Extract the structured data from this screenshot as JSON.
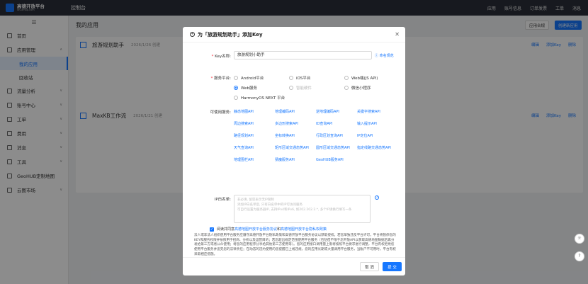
{
  "topbar": {
    "logo_title": "高德开放平台",
    "logo_sub": "lbs.amap.com",
    "console": "控制台",
    "nav": [
      "应用",
      "账号信息",
      "订单发票",
      "工单",
      "消息"
    ]
  },
  "sidebar": {
    "collapse": "☰",
    "items": [
      {
        "label": "首页"
      },
      {
        "label": "应用管理",
        "arrow": "∧"
      },
      {
        "label": "流量分析",
        "arrow": "∨"
      },
      {
        "label": "账号中心",
        "arrow": "∨"
      },
      {
        "label": "工单",
        "arrow": "∨"
      },
      {
        "label": "费用",
        "arrow": "∨"
      },
      {
        "label": "消息",
        "arrow": "∨"
      },
      {
        "label": "工具",
        "arrow": "∨"
      },
      {
        "label": "GeoHUB定制地图"
      },
      {
        "label": "云图市场",
        "arrow": "∨"
      }
    ],
    "sub_items": [
      "我的应用",
      "回收站"
    ]
  },
  "main": {
    "title": "我的应用",
    "btn_compliance": "应用合规",
    "btn_create": "创建新应用",
    "apps": [
      {
        "name": "旅游规划助手",
        "date": "2026/1/26 创建"
      },
      {
        "name": "MaxKB工作流",
        "date": "2026/1/21 创建"
      }
    ],
    "app_actions": [
      "编辑",
      "添加Key",
      "删除"
    ]
  },
  "modal": {
    "title": "为「旅游规划助手」添加Key",
    "close": "✕",
    "key_label": "Key名称:",
    "key_value": "旅游规划小助手",
    "naming_rule": "命名规范",
    "platform_label": "服务平台:",
    "platforms": [
      {
        "label": "Android平台",
        "checked": false,
        "disabled": false
      },
      {
        "label": "iOS平台",
        "checked": false,
        "disabled": false
      },
      {
        "label": "Web端(JS API)",
        "checked": false,
        "disabled": false
      },
      {
        "label": "Web服务",
        "checked": true,
        "disabled": false
      },
      {
        "label": "智能硬件",
        "checked": false,
        "disabled": true
      },
      {
        "label": "微信小程序",
        "checked": false,
        "disabled": false
      },
      {
        "label": "HarmonyOS NEXT 平台",
        "checked": false,
        "disabled": false
      }
    ],
    "services_label": "可使用服务:",
    "services": [
      "静态地图API",
      "地理编码API",
      "逆地理编码API",
      "关键字搜索API",
      "周边搜索API",
      "多边形搜索API",
      "ID查询API",
      "输入提示API",
      "路径规划API",
      "坐标转换API",
      "行政区划查询API",
      "IP定位API",
      "天气查询API",
      "矩形区域交通态势API",
      "圆形区域交通态势API",
      "指定线路交通态势API",
      "地理围栏API",
      "猜魔服务API",
      "GeoHUB服务API"
    ],
    "ip_label": "IP白名单:",
    "ip_placeholder": "非必填, 留空表示无IP限制\n添加IP白名单后, 只有白名单中的IP可访问服务\n可自行设置为服务器IP, 支持IPv4和IPv6, 如202.202.2.*, 多个IP请换行填写一条",
    "help": "?",
    "agree_text": "阅读并同意",
    "agree_link1": "高德地图开放平台服务协议",
    "agree_and": "和",
    "agree_link2": "高德地图开放平台隐私权政策",
    "terms": "法人或非法人组织使用平台服务应遵守高德开放平台隐私政策和高德开放平台服务协议以获取授权。若您单独违反平台许可，平台将暂停您的KEY和服务权限并依照用于招商、分析以及运营目的；若您超出规定范围使用平台服务（包括但不限于您开放API以获取高德地图数据后再分发给第三方或者公众使用；将您的应用程序分享给其他第三方使用等）。您的应用接口调用量上限将按照平台要求进行调整，平台有权拒绝您使用平台服务并追究您的法律责任；在动态的违约使用的您提醒已上线违规，您的应用长期或大量调用平台服务，当账户不可用时，平台有权采取相应措施。",
    "cancel": "取 消",
    "submit": "提 交"
  },
  "fab": [
    "☼",
    "?"
  ]
}
